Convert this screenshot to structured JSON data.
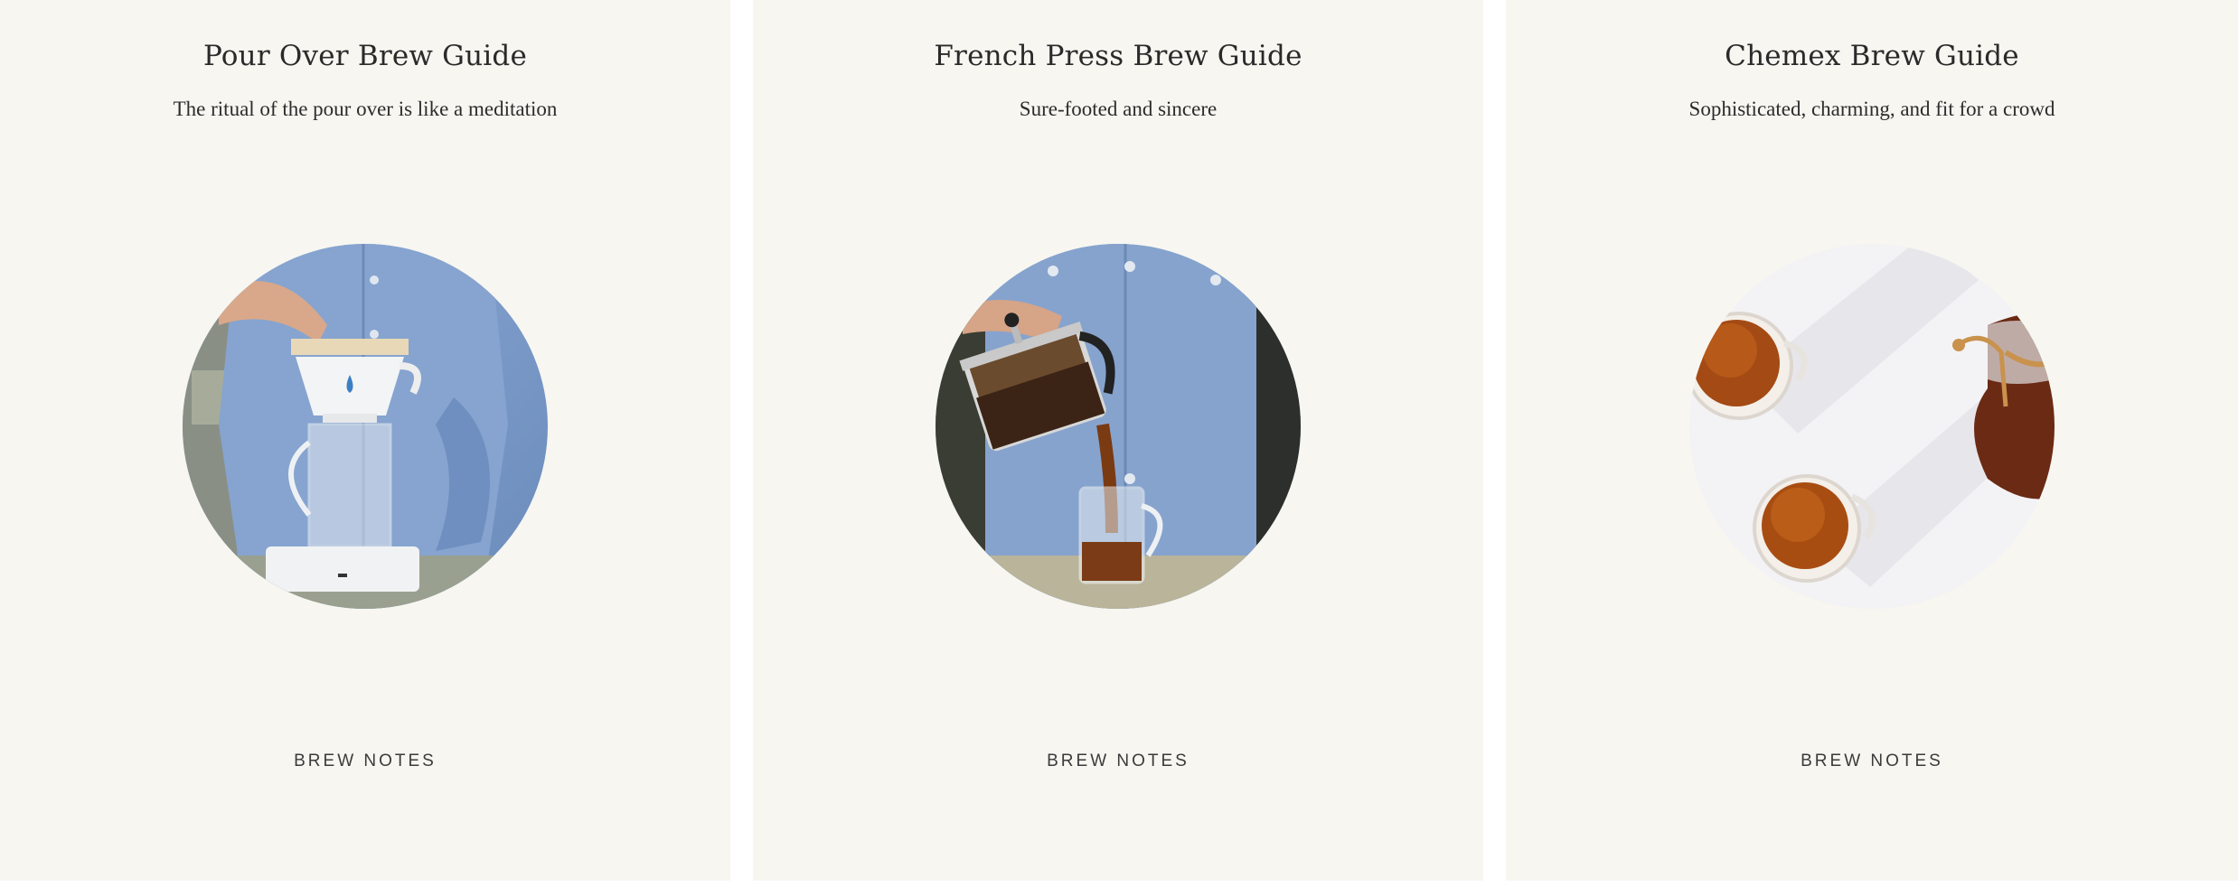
{
  "guides": [
    {
      "title": "Pour Over Brew Guide",
      "subtitle": "The ritual of the pour over is like a meditation",
      "link_label": "BREW NOTES"
    },
    {
      "title": "French Press Brew Guide",
      "subtitle": "Sure-footed and sincere",
      "link_label": "BREW NOTES"
    },
    {
      "title": "Chemex Brew Guide",
      "subtitle": "Sophisticated, charming, and fit for a crowd",
      "link_label": "BREW NOTES"
    }
  ],
  "colors": {
    "card_background": "#f7f6f1",
    "page_background": "#ffffff",
    "shirt_blue": "#7e9fcb",
    "coffee": "#5a2a10"
  }
}
